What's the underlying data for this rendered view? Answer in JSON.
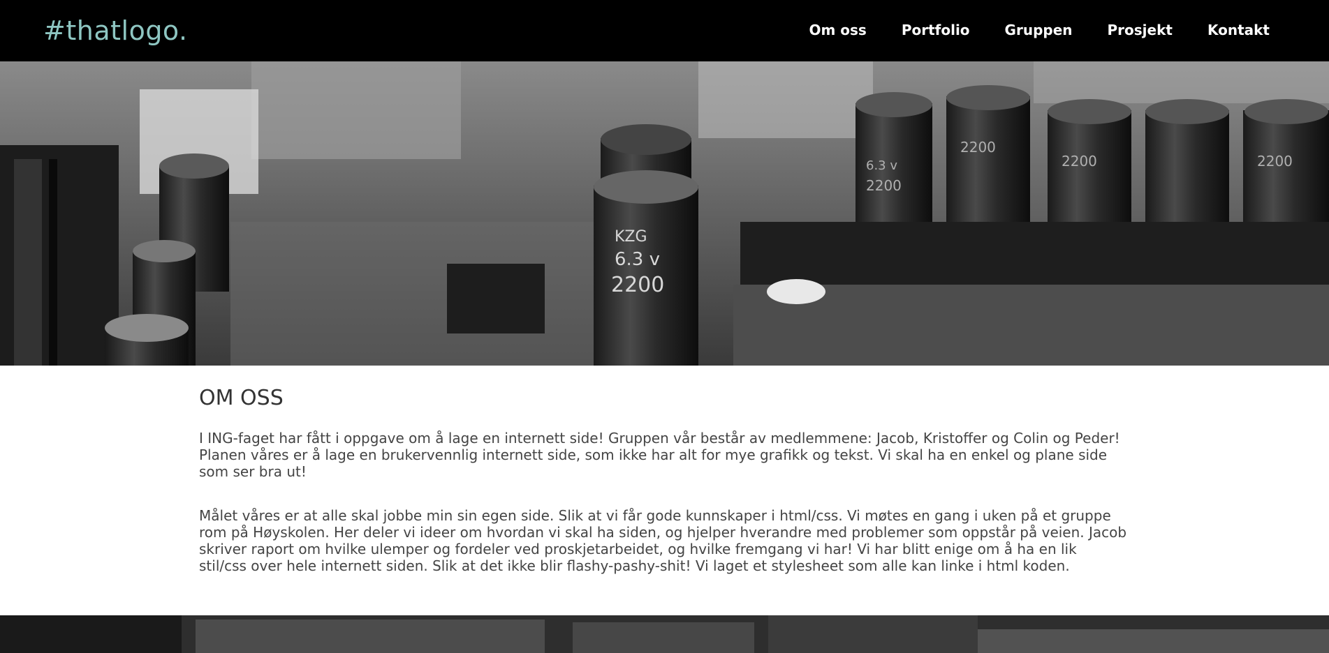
{
  "header": {
    "logo": "#thatlogo.",
    "nav": [
      "Om oss",
      "Portfolio",
      "Gruppen",
      "Prosjekt",
      "Kontakt"
    ]
  },
  "hero": {
    "image": "circuit-board-photo",
    "capacitor_labels": [
      "KZG",
      "6.3 v",
      "2200",
      "6.3 v",
      "2200",
      "2200",
      "2200",
      "2200"
    ]
  },
  "main": {
    "title": "OM OSS",
    "paragraphs": [
      "I ING-faget har fått i oppgave om å lage en internett side! Gruppen vår består av medlemmene: Jacob, Kristoffer og Colin og Peder! Planen våres er å lage en brukervennlig internett side, som ikke har alt for mye grafikk og tekst. Vi skal ha en enkel og plane side som ser bra ut!",
      "Målet våres er at alle skal jobbe min sin egen side. Slik at vi får gode kunnskaper i html/css. Vi møtes en gang i uken på et gruppe rom på Høyskolen. Her deler vi ideer om hvordan vi skal ha siden, og hjelper hverandre med problemer som oppstår på veien. Jacob skriver raport om hvilke ulemper og fordeler ved proskjetarbeidet, og hvilke fremgang vi har! Vi har blitt enige om å ha en lik stil/css over hele internett siden. Slik at det ikke blir flashy-pashy-shit! Vi laget et stylesheet som alle kan linke i html koden."
    ]
  },
  "colors": {
    "header_bg": "#000000",
    "logo": "#8ec6c2",
    "nav_text": "#ffffff",
    "body_text": "#444444"
  }
}
